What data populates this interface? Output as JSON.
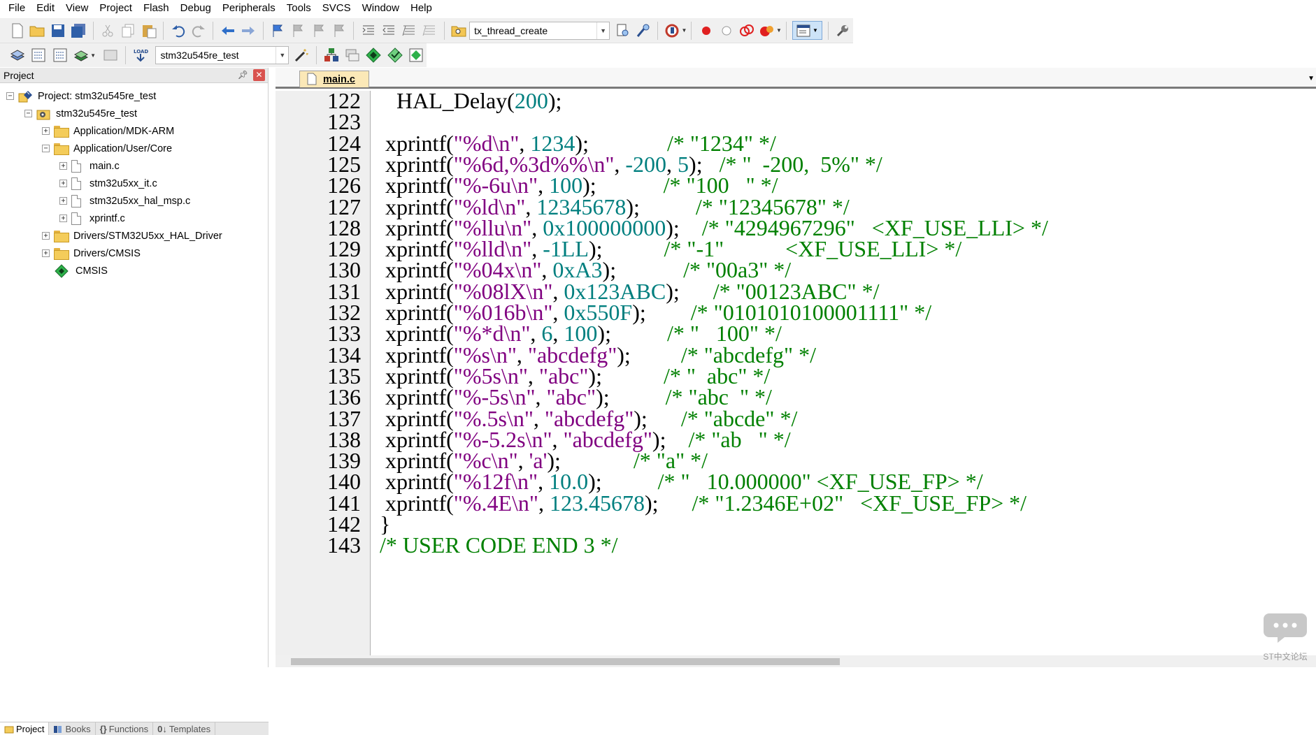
{
  "menubar": {
    "items": [
      "File",
      "Edit",
      "View",
      "Project",
      "Flash",
      "Debug",
      "Peripherals",
      "Tools",
      "SVCS",
      "Window",
      "Help"
    ]
  },
  "toolbar1": {
    "find_target": "tx_thread_create"
  },
  "toolbar2": {
    "target_select": "stm32u545re_test",
    "load_label": "LOAD"
  },
  "project_panel": {
    "title": "Project",
    "close_glyph": "✕",
    "tree": {
      "root": "Project: stm32u545re_test",
      "target": "stm32u545re_test",
      "groups": [
        {
          "label": "Application/MDK-ARM",
          "expanded": false
        },
        {
          "label": "Application/User/Core",
          "expanded": true,
          "files": [
            "main.c",
            "stm32u5xx_it.c",
            "stm32u5xx_hal_msp.c",
            "xprintf.c"
          ]
        },
        {
          "label": "Drivers/STM32U5xx_HAL_Driver",
          "expanded": false
        },
        {
          "label": "Drivers/CMSIS",
          "expanded": false
        }
      ],
      "cmsis": "CMSIS"
    },
    "bottom_tabs": [
      "Project",
      "Books",
      "Functions",
      "Templates"
    ]
  },
  "editor": {
    "tab": "main.c",
    "lines": [
      {
        "num": "122",
        "t": [
          [
            "p",
            "    HAL_Delay("
          ],
          [
            "n",
            "200"
          ],
          [
            "p",
            ");"
          ]
        ]
      },
      {
        "num": "123",
        "t": []
      },
      {
        "num": "124",
        "t": [
          [
            "p",
            "  xprintf("
          ],
          [
            "s",
            "\"%d\\n\""
          ],
          [
            "p",
            ", "
          ],
          [
            "n",
            "1234"
          ],
          [
            "p",
            ");"
          ],
          [
            "pad",
            "              "
          ],
          [
            "c",
            "/* \"1234\" */"
          ]
        ]
      },
      {
        "num": "125",
        "t": [
          [
            "p",
            "  xprintf("
          ],
          [
            "s",
            "\"%6d,%3d%%\\n\""
          ],
          [
            "p",
            ", "
          ],
          [
            "n",
            "-200"
          ],
          [
            "p",
            ", "
          ],
          [
            "n",
            "5"
          ],
          [
            "p",
            ");"
          ],
          [
            "pad",
            "   "
          ],
          [
            "c",
            "/* \"  -200,  5%\" */"
          ]
        ]
      },
      {
        "num": "126",
        "t": [
          [
            "p",
            "  xprintf("
          ],
          [
            "s",
            "\"%-6u\\n\""
          ],
          [
            "p",
            ", "
          ],
          [
            "n",
            "100"
          ],
          [
            "p",
            ");"
          ],
          [
            "pad",
            "            "
          ],
          [
            "c",
            "/* \"100   \" */"
          ]
        ]
      },
      {
        "num": "127",
        "t": [
          [
            "p",
            "  xprintf("
          ],
          [
            "s",
            "\"%ld\\n\""
          ],
          [
            "p",
            ", "
          ],
          [
            "n",
            "12345678"
          ],
          [
            "p",
            ");"
          ],
          [
            "pad",
            "          "
          ],
          [
            "c",
            "/* \"12345678\" */"
          ]
        ]
      },
      {
        "num": "128",
        "t": [
          [
            "p",
            "  xprintf("
          ],
          [
            "s",
            "\"%llu\\n\""
          ],
          [
            "p",
            ", "
          ],
          [
            "n",
            "0x100000000"
          ],
          [
            "p",
            ");"
          ],
          [
            "pad",
            "    "
          ],
          [
            "c",
            "/* \"4294967296\"   <XF_USE_LLI> */"
          ]
        ]
      },
      {
        "num": "129",
        "t": [
          [
            "p",
            "  xprintf("
          ],
          [
            "s",
            "\"%lld\\n\""
          ],
          [
            "p",
            ", "
          ],
          [
            "n",
            "-1LL"
          ],
          [
            "p",
            ");"
          ],
          [
            "pad",
            "           "
          ],
          [
            "c",
            "/* \"-1\"           <XF_USE_LLI> */"
          ]
        ]
      },
      {
        "num": "130",
        "t": [
          [
            "p",
            "  xprintf("
          ],
          [
            "s",
            "\"%04x\\n\""
          ],
          [
            "p",
            ", "
          ],
          [
            "n",
            "0xA3"
          ],
          [
            "p",
            ");"
          ],
          [
            "pad",
            "            "
          ],
          [
            "c",
            "/* \"00a3\" */"
          ]
        ]
      },
      {
        "num": "131",
        "t": [
          [
            "p",
            "  xprintf("
          ],
          [
            "s",
            "\"%08lX\\n\""
          ],
          [
            "p",
            ", "
          ],
          [
            "n",
            "0x123ABC"
          ],
          [
            "p",
            ");"
          ],
          [
            "pad",
            "      "
          ],
          [
            "c",
            "/* \"00123ABC\" */"
          ]
        ]
      },
      {
        "num": "132",
        "t": [
          [
            "p",
            "  xprintf("
          ],
          [
            "s",
            "\"%016b\\n\""
          ],
          [
            "p",
            ", "
          ],
          [
            "n",
            "0x550F"
          ],
          [
            "p",
            ");"
          ],
          [
            "pad",
            "        "
          ],
          [
            "c",
            "/* \"0101010100001111\" */"
          ]
        ]
      },
      {
        "num": "133",
        "t": [
          [
            "p",
            "  xprintf("
          ],
          [
            "s",
            "\"%*d\\n\""
          ],
          [
            "p",
            ", "
          ],
          [
            "n",
            "6"
          ],
          [
            "p",
            ", "
          ],
          [
            "n",
            "100"
          ],
          [
            "p",
            ");"
          ],
          [
            "pad",
            "          "
          ],
          [
            "c",
            "/* \"   100\" */"
          ]
        ]
      },
      {
        "num": "134",
        "t": [
          [
            "p",
            "  xprintf("
          ],
          [
            "s",
            "\"%s\\n\""
          ],
          [
            "p",
            ", "
          ],
          [
            "s",
            "\"abcdefg\""
          ],
          [
            "p",
            ");"
          ],
          [
            "pad",
            "         "
          ],
          [
            "c",
            "/* \"abcdefg\" */"
          ]
        ]
      },
      {
        "num": "135",
        "t": [
          [
            "p",
            "  xprintf("
          ],
          [
            "s",
            "\"%5s\\n\""
          ],
          [
            "p",
            ", "
          ],
          [
            "s",
            "\"abc\""
          ],
          [
            "p",
            ");"
          ],
          [
            "pad",
            "           "
          ],
          [
            "c",
            "/* \"  abc\" */"
          ]
        ]
      },
      {
        "num": "136",
        "t": [
          [
            "p",
            "  xprintf("
          ],
          [
            "s",
            "\"%-5s\\n\""
          ],
          [
            "p",
            ", "
          ],
          [
            "s",
            "\"abc\""
          ],
          [
            "p",
            ");"
          ],
          [
            "pad",
            "          "
          ],
          [
            "c",
            "/* \"abc  \" */"
          ]
        ]
      },
      {
        "num": "137",
        "t": [
          [
            "p",
            "  xprintf("
          ],
          [
            "s",
            "\"%.5s\\n\""
          ],
          [
            "p",
            ", "
          ],
          [
            "s",
            "\"abcdefg\""
          ],
          [
            "p",
            ");"
          ],
          [
            "pad",
            "      "
          ],
          [
            "c",
            "/* \"abcde\" */"
          ]
        ]
      },
      {
        "num": "138",
        "t": [
          [
            "p",
            "  xprintf("
          ],
          [
            "s",
            "\"%-5.2s\\n\""
          ],
          [
            "p",
            ", "
          ],
          [
            "s",
            "\"abcdefg\""
          ],
          [
            "p",
            ");"
          ],
          [
            "pad",
            "    "
          ],
          [
            "c",
            "/* \"ab   \" */"
          ]
        ]
      },
      {
        "num": "139",
        "t": [
          [
            "p",
            "  xprintf("
          ],
          [
            "s",
            "\"%c\\n\""
          ],
          [
            "p",
            ", "
          ],
          [
            "s",
            "'a'"
          ],
          [
            "p",
            ");"
          ],
          [
            "pad",
            "             "
          ],
          [
            "c",
            "/* \"a\" */"
          ]
        ]
      },
      {
        "num": "140",
        "t": [
          [
            "p",
            "  xprintf("
          ],
          [
            "s",
            "\"%12f\\n\""
          ],
          [
            "p",
            ", "
          ],
          [
            "n",
            "10.0"
          ],
          [
            "p",
            ");"
          ],
          [
            "pad",
            "          "
          ],
          [
            "c",
            "/* \"   10.000000\" <XF_USE_FP> */"
          ]
        ]
      },
      {
        "num": "141",
        "t": [
          [
            "p",
            "  xprintf("
          ],
          [
            "s",
            "\"%.4E\\n\""
          ],
          [
            "p",
            ", "
          ],
          [
            "n",
            "123.45678"
          ],
          [
            "p",
            ");"
          ],
          [
            "pad",
            "      "
          ],
          [
            "c",
            "/* \"1.2346E+02\"   <XF_USE_FP> */"
          ]
        ]
      },
      {
        "num": "142",
        "t": [
          [
            "p",
            " }"
          ]
        ]
      },
      {
        "num": "143",
        "t": [
          [
            "p",
            " "
          ],
          [
            "c",
            "/* USER CODE END 3 */"
          ]
        ]
      }
    ]
  },
  "watermark": {
    "text": "ST中文论坛"
  },
  "colors": {
    "string": "#800080",
    "number": "#007f7f",
    "comment": "#008000",
    "gutter": "#efefef",
    "tab_active": "#fbe8b7"
  }
}
